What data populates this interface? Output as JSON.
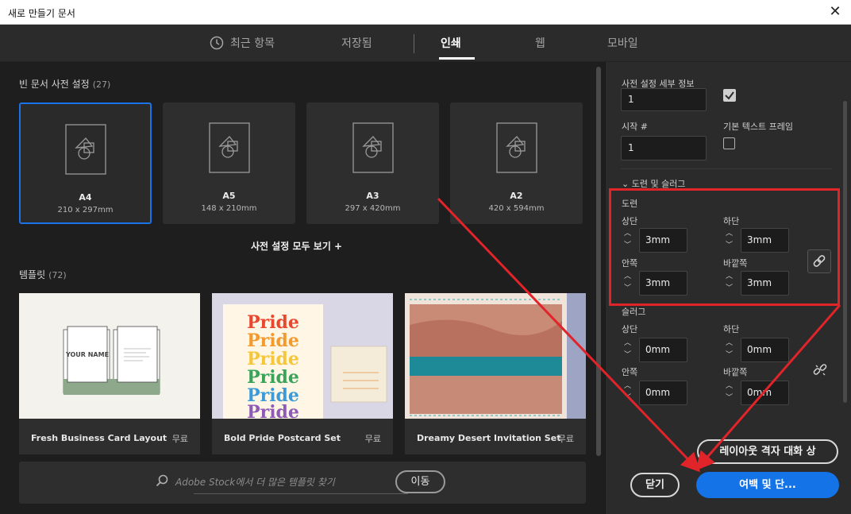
{
  "window": {
    "title": "새로 만들기 문서",
    "close_glyph": "✕"
  },
  "tabs": [
    {
      "label": "최근 항목",
      "icon": "clock-icon"
    },
    {
      "label": "저장됨"
    },
    {
      "label": "인쇄",
      "active": true
    },
    {
      "label": "웹"
    },
    {
      "label": "모바일"
    }
  ],
  "presets": {
    "title": "빈 문서 사전 설정",
    "count": "(27)",
    "items": [
      {
        "name": "A4",
        "size": "210 x 297mm",
        "selected": true
      },
      {
        "name": "A5",
        "size": "148 x 210mm"
      },
      {
        "name": "A3",
        "size": "297 x 420mm"
      },
      {
        "name": "A2",
        "size": "420 x 594mm"
      }
    ],
    "view_all": "사전 설정 모두 보기 +"
  },
  "templates": {
    "title": "템플릿",
    "count": "(72)",
    "items": [
      {
        "name": "Fresh Business Card Layout",
        "price": "무료",
        "card_text": "YOUR NAME"
      },
      {
        "name": "Bold Pride Postcard Set",
        "price": "무료",
        "words": [
          "Pride",
          "Pride",
          "Pride",
          "Pride",
          "Pride",
          "Pride"
        ],
        "word_colors": [
          "#e8482f",
          "#f29a2e",
          "#f5c63a",
          "#3aa35a",
          "#3e9ad6",
          "#8d5bb5"
        ]
      },
      {
        "name": "Dreamy Desert Invitation Set",
        "price": "무료"
      }
    ]
  },
  "search": {
    "placeholder": "Adobe Stock에서 더 많은 템플릿 찾기",
    "go_label": "이동"
  },
  "details": {
    "title": "사전 설정 세부 정보",
    "pages_value": "1",
    "start_label": "시작 #",
    "start_value": "1",
    "text_frame_label": "기본 텍스트 프레임",
    "bleed_slug_section": "도련 및 슬러그",
    "bleed": {
      "title": "도련",
      "top_label": "상단",
      "top_value": "3mm",
      "bottom_label": "하단",
      "bottom_value": "3mm",
      "inside_label": "안쪽",
      "inside_value": "3mm",
      "outside_label": "바깥쪽",
      "outside_value": "3mm"
    },
    "slug": {
      "title": "슬러그",
      "top_label": "상단",
      "top_value": "0mm",
      "bottom_label": "하단",
      "bottom_value": "0mm",
      "inside_label": "안쪽",
      "inside_value": "0mm",
      "outside_label": "바깥쪽",
      "outside_value": "0mm"
    }
  },
  "buttons": {
    "layout_grid": "레이아웃 격자 대화 상",
    "close": "닫기",
    "margins_columns": "여백 및 단..."
  },
  "colors": {
    "accent": "#1473e6",
    "highlight": "#e0242a"
  }
}
